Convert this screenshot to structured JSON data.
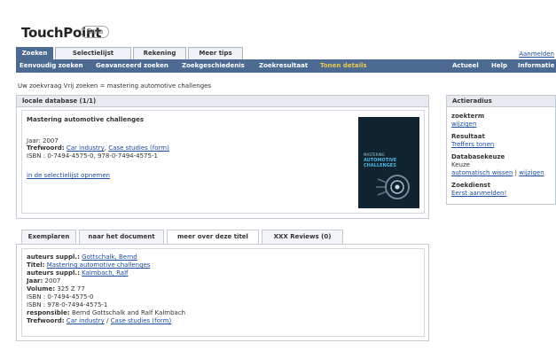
{
  "app": {
    "name": "TouchPoint",
    "badge": "Beta",
    "login": "Aanmelden"
  },
  "main_tabs": [
    {
      "label": "Zoeken",
      "active": true
    },
    {
      "label": "Selectielijst",
      "active": false
    },
    {
      "label": "Rekening",
      "active": false
    },
    {
      "label": "Meer tips",
      "active": false
    }
  ],
  "subnav": {
    "left": [
      "Eenvoudig zoeken",
      "Geavanceerd zoeken",
      "Zoekgeschiedenis",
      "Zoekresultaat",
      "Tonen details"
    ],
    "right": [
      "Actueel",
      "Help",
      "Informatie"
    ],
    "highlight": "Tonen details"
  },
  "query": "Uw zoekvraag Vrij zoeken = mastering automotive challenges",
  "database_panel": {
    "title": "locale database (1/1)",
    "record": {
      "title": "Mastering automotive challenges",
      "year_label": "Jaar:",
      "year": "2007",
      "keyword_label": "Trefwoord:",
      "keyword1": "Car industry",
      "sep": ",",
      "keyword2": "Case studies (form)",
      "isbn_label": "ISBN :",
      "isbn": "0-7494-4575-0, 978-0-7494-4575-1",
      "add_link": "in de selectielijst opnemen"
    },
    "cover": {
      "subtitle": "MASTERING",
      "title1": "AUTOMOTIVE",
      "title2": "CHALLENGES"
    }
  },
  "side_panel": {
    "title": "Actieradius",
    "search_term_label": "zoekterm",
    "search_term_link": "wijzigen",
    "result_label": "Resultaat",
    "result_link": "Treffers tonen",
    "db_choice_label": "Databasekeuze",
    "db_choice_value": "Keuze",
    "db_auto_link": "automatisch wissen",
    "db_sep": "|",
    "db_change_link": "wijzigen",
    "service_label": "Zoekdienst",
    "service_link": "Eerst aanmelden!"
  },
  "detail_tabs": [
    {
      "label": "Exemplaren",
      "active": false
    },
    {
      "label": "naar het document",
      "active": false
    },
    {
      "label": "meer over deze titel",
      "active": true
    },
    {
      "label": "XXX Reviews (0)",
      "active": false
    }
  ],
  "details": {
    "author1_label": "auteurs suppl.:",
    "author1": "Gottschalk, Bernd",
    "title_label": "Titel:",
    "title": "Mastering automotive challenges",
    "author2_label": "auteurs suppl.:",
    "author2": "Kalmbach, Ralf",
    "year_label": "Jaar:",
    "year": "2007",
    "volume_label": "Volume:",
    "volume": "325 Z 77",
    "isbn1_label": "ISBN :",
    "isbn1": "0-7494-4575-0",
    "isbn2_label": "ISBN :",
    "isbn2": "978-0-7494-4575-1",
    "resp_label": "responsible:",
    "resp": "Bernd Gottschalk and Ralf Kalmbach",
    "kw_label": "Trefwoord:",
    "kw1": "Car industry",
    "kw_sep": "/",
    "kw2": "Case studies (form)"
  }
}
